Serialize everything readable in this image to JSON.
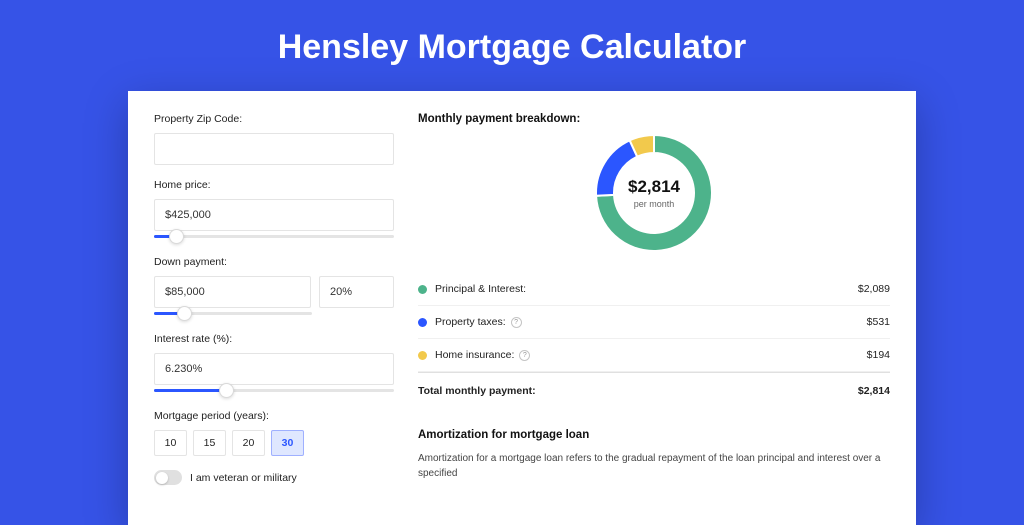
{
  "page_title": "Hensley Mortgage Calculator",
  "colors": {
    "principal": "#4db38b",
    "taxes": "#2b56ff",
    "insurance": "#f2c94c"
  },
  "form": {
    "zip": {
      "label": "Property Zip Code:",
      "value": ""
    },
    "home_price": {
      "label": "Home price:",
      "value": "$425,000",
      "slider_pct": 9
    },
    "down_payment": {
      "label": "Down payment:",
      "amount": "$85,000",
      "percent": "20%",
      "slider_pct": 19
    },
    "interest_rate": {
      "label": "Interest rate (%):",
      "value": "6.230%",
      "slider_pct": 30
    },
    "mortgage_period": {
      "label": "Mortgage period (years):",
      "options": [
        "10",
        "15",
        "20",
        "30"
      ],
      "selected": "30"
    },
    "veteran": {
      "label": "I am veteran or military",
      "checked": false
    }
  },
  "breakdown": {
    "title": "Monthly payment breakdown:",
    "center_value": "$2,814",
    "center_sub": "per month",
    "items": [
      {
        "key": "principal",
        "label": "Principal & Interest:",
        "value": "$2,089",
        "info": false
      },
      {
        "key": "taxes",
        "label": "Property taxes:",
        "value": "$531",
        "info": true
      },
      {
        "key": "insurance",
        "label": "Home insurance:",
        "value": "$194",
        "info": true
      }
    ],
    "total": {
      "label": "Total monthly payment:",
      "value": "$2,814"
    }
  },
  "amortization": {
    "title": "Amortization for mortgage loan",
    "text": "Amortization for a mortgage loan refers to the gradual repayment of the loan principal and interest over a specified"
  },
  "chart_data": {
    "type": "pie",
    "title": "Monthly payment breakdown",
    "series": [
      {
        "name": "Principal & Interest",
        "value": 2089,
        "color": "#4db38b"
      },
      {
        "name": "Property taxes",
        "value": 531,
        "color": "#2b56ff"
      },
      {
        "name": "Home insurance",
        "value": 194,
        "color": "#f2c94c"
      }
    ],
    "total": 2814,
    "center_label": "$2,814 per month"
  }
}
